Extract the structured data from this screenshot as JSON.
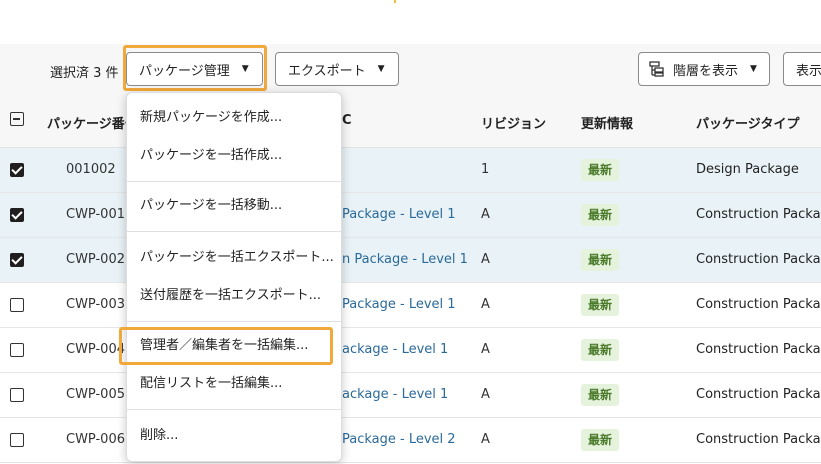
{
  "toolbar": {
    "selected_count": "選択済 3 件",
    "package_manage_label": "パッケージ管理",
    "export_label": "エクスポート",
    "show_hierarchy_label": "階層を表示",
    "show_label": "表示"
  },
  "table": {
    "headers": {
      "package_number": "パッケージ番号",
      "name": "C",
      "revision": "リビジョン",
      "update_info": "更新情報",
      "package_type": "パッケージタイプ"
    },
    "rows": [
      {
        "checked": true,
        "number": "001002",
        "name": "",
        "revision": "1",
        "status": "最新",
        "type": "Design Package"
      },
      {
        "checked": true,
        "number": "CWP-001",
        "name": "Package - Level 1",
        "revision": "A",
        "status": "最新",
        "type": "Construction Package"
      },
      {
        "checked": true,
        "number": "CWP-002",
        "name": "n Package  - Level 1",
        "revision": "A",
        "status": "最新",
        "type": "Construction Package"
      },
      {
        "checked": false,
        "number": "CWP-003",
        "name": "Package  - Level 1",
        "revision": "A",
        "status": "最新",
        "type": "Construction Package"
      },
      {
        "checked": false,
        "number": "CWP-004",
        "name": "ackage  - Level 1",
        "revision": "A",
        "status": "最新",
        "type": "Construction Package"
      },
      {
        "checked": false,
        "number": "CWP-005",
        "name": "ackage  - Level 1",
        "revision": "A",
        "status": "最新",
        "type": "Construction Package"
      },
      {
        "checked": false,
        "number": "CWP-006",
        "name": "Package - Level 2",
        "revision": "A",
        "status": "最新",
        "type": "Construction Package"
      }
    ]
  },
  "menu": {
    "items": [
      "新規パッケージを作成...",
      "パッケージを一括作成...",
      "パッケージを一括移動...",
      "パッケージを一括エクスポート...",
      "送付履歴を一括エクスポート...",
      "管理者／編集者を一括編集...",
      "配信リストを一括編集...",
      "削除..."
    ],
    "highlighted_item_index": 5
  },
  "colors": {
    "highlight_outline": "#f2a93b",
    "selected_row": "#e9f3f7",
    "badge_bg": "#e5f2dc",
    "badge_text": "#4a7a2a",
    "link": "#2b6a9a"
  },
  "icons": [
    "caret-down-icon",
    "hierarchy-icon",
    "checkbox-icon"
  ]
}
